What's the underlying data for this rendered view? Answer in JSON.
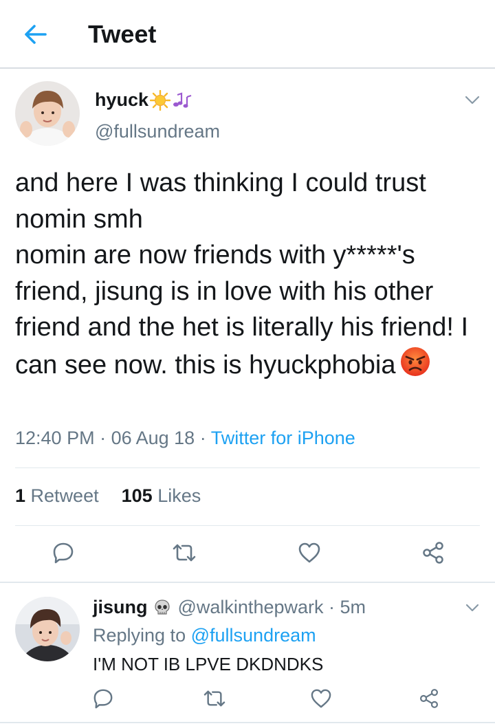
{
  "header": {
    "title": "Tweet"
  },
  "main_tweet": {
    "name": "hyuck",
    "name_emojis": "☀️🎶",
    "handle": "@fullsundream",
    "text": "and here I was thinking I could trust nomin smh\nnomin are now friends with y*****'s friend, jisung is in love with his other friend and the het is literally his friend! I can see now. this is hyuckphobia",
    "text_emoji": "😡",
    "time": "12:40 PM",
    "date": "06 Aug 18",
    "source": "Twitter for iPhone",
    "retweet_count": "1",
    "retweet_label": "Retweet",
    "like_count": "105",
    "like_label": "Likes"
  },
  "reply": {
    "name": "jisung",
    "name_emoji": "💀",
    "handle": "@walkinthepwark",
    "time": "5m",
    "replying_prefix": "Replying to",
    "replying_to": "@fullsundream",
    "text": "I'M NOT IB LPVE DKDNDKS"
  },
  "colors": {
    "accent": "#1da1f2",
    "secondary_text": "#657786",
    "primary_text": "#14171a",
    "divider": "#e1e8ed"
  },
  "icons": [
    "back-arrow-icon",
    "chevron-down-icon",
    "reply-icon",
    "retweet-icon",
    "like-icon",
    "share-icon",
    "angry-face-icon",
    "sun-icon",
    "music-notes-icon",
    "skull-icon"
  ]
}
